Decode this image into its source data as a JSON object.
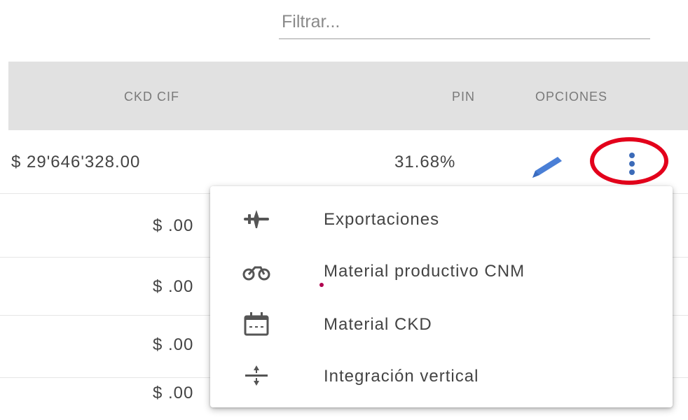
{
  "filter": {
    "placeholder": "Filtrar..."
  },
  "table": {
    "headers": {
      "ckd_cif": "CKD CIF",
      "pin": "PIN",
      "opciones": "OPCIONES"
    },
    "rows": [
      {
        "ckd_cif": "$ 29'646'328.00",
        "pin": "31.68%"
      },
      {
        "ckd_cif": "$ .00"
      },
      {
        "ckd_cif": "$ .00"
      },
      {
        "ckd_cif": "$ .00"
      },
      {
        "ckd_cif": "$ .00"
      }
    ]
  },
  "row_actions": {
    "edit_icon": "pencil-icon",
    "more_icon": "more-vert-icon"
  },
  "menu": {
    "items": [
      {
        "label": "Exportaciones",
        "icon": "airplane-icon"
      },
      {
        "label": "Material productivo CNM",
        "icon": "bicycle-icon"
      },
      {
        "label": "Material CKD",
        "icon": "calendar-icon"
      },
      {
        "label": "Integración vertical",
        "icon": "divide-icon"
      }
    ]
  },
  "colors": {
    "accent": "#4a7fd6",
    "highlight": "#e3001b",
    "header_bg": "#e1e1e1"
  }
}
